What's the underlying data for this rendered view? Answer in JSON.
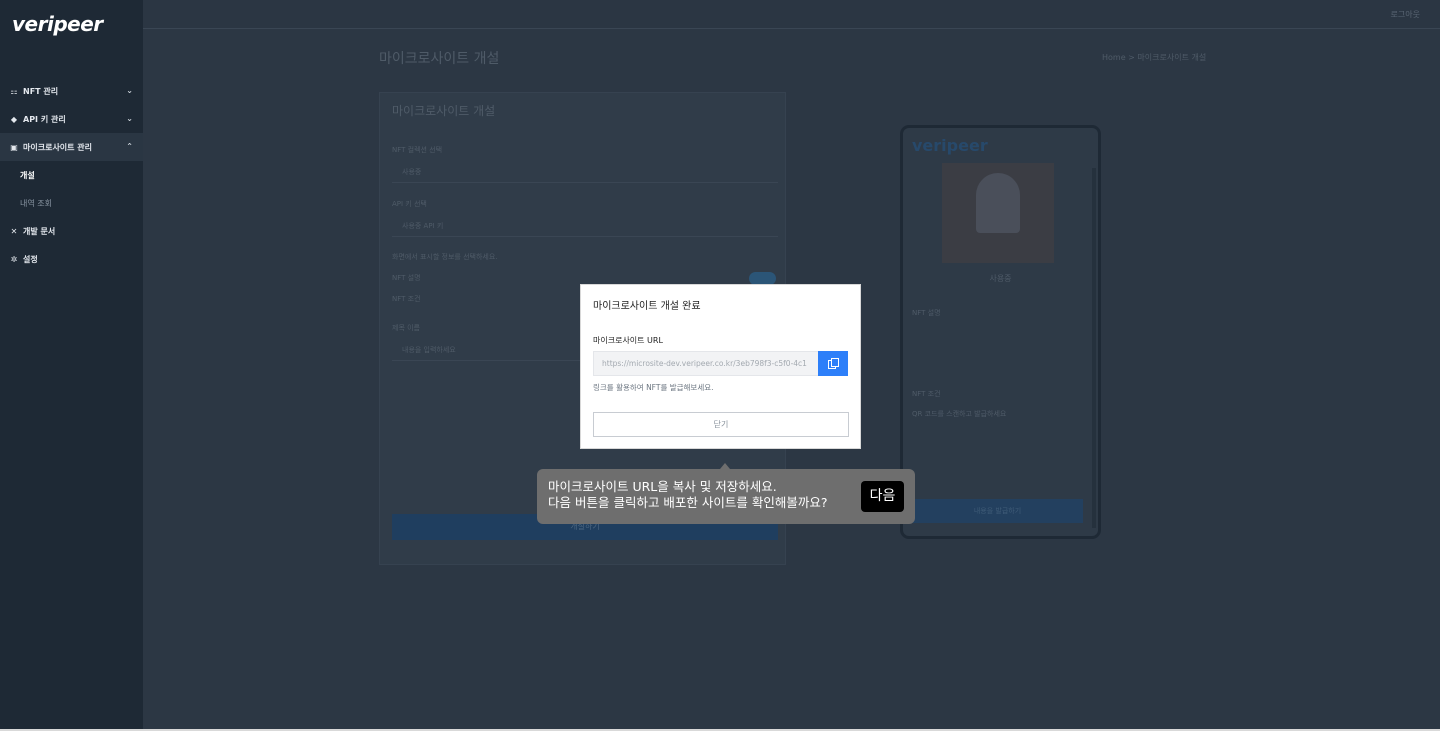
{
  "app": {
    "brand": "veripeer",
    "logout_label": "로그아웃"
  },
  "sidebar": {
    "items": [
      {
        "label": "NFT 관리",
        "icon": "sitemap-icon",
        "expanded": false
      },
      {
        "label": "API 키 관리",
        "icon": "tag-icon",
        "expanded": false
      },
      {
        "label": "마이크로사이트 관리",
        "icon": "window-icon",
        "expanded": true
      },
      {
        "label": "개발 문서",
        "icon": "tools-icon"
      },
      {
        "label": "설정",
        "icon": "gear-icon"
      }
    ],
    "sub_items": [
      {
        "label": "개설",
        "current": true
      },
      {
        "label": "내역 조회",
        "current": false
      }
    ]
  },
  "page": {
    "title": "마이크로사이트 개설",
    "breadcrumb": "Home > 마이크로사이트 개설"
  },
  "form": {
    "title": "마이크로사이트 개설",
    "collection_label": "NFT 컬렉션 선택",
    "collection_value": "사용중",
    "apikey_label": "API 키 선택",
    "apikey_value": "사용중 API 키",
    "display_label": "화면에서 표시할 정보를 선택하세요.",
    "opt1": "NFT 설명",
    "opt2": "NFT 조건",
    "button_label": "제목 이름",
    "button_placeholder": "내용을 입력하세요",
    "submit": "개설하기"
  },
  "preview": {
    "brand": "veripeer",
    "name": "사용중",
    "desc_label": "NFT 설명",
    "cond_label": "NFT 조건",
    "cond_text": "QR 코드를 스캔하고 발급하세요",
    "button": "내용을 발급하기"
  },
  "modal": {
    "title": "마이크로사이트 개설 완료",
    "url_label": "마이크로사이트 URL",
    "url_value": "https://microsite-dev.veripeer.co.kr/3eb798f3-c5f0-4c1",
    "hint": "링크를 활용하여 NFT를 발급해보세요.",
    "close_label": "닫기"
  },
  "tooltip": {
    "line1": "마이크로사이트 URL을 복사 및 저장하세요.",
    "line2": "다음 버튼을 클릭하고 배포한 사이트를 확인해볼까요?",
    "next_label": "다음"
  },
  "colors": {
    "sidebar_bg": "#1e2935",
    "primary": "#2d7ff9",
    "tooltip_bg": "#6e6e6e"
  }
}
